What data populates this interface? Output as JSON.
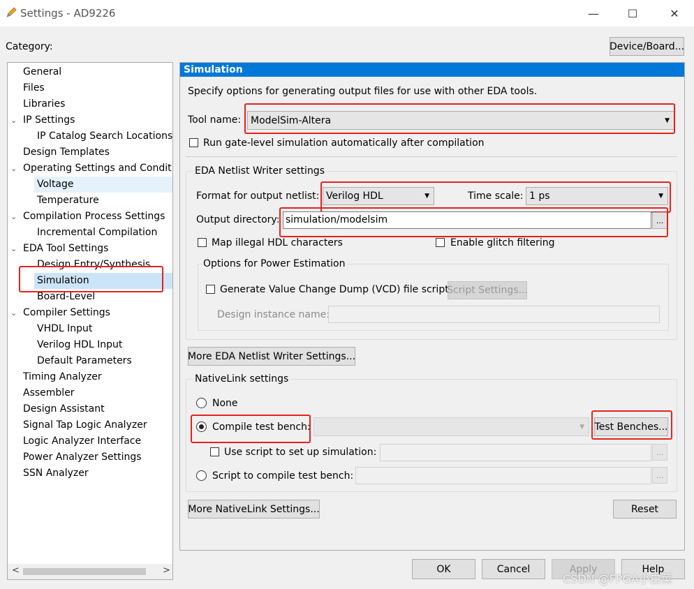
{
  "window": {
    "title": "Settings - AD9226",
    "minimize": "—",
    "maximize": "☐",
    "close": "✕"
  },
  "category_label": "Category:",
  "device_board_button": "Device/Board...",
  "tree": {
    "items": [
      {
        "label": "General"
      },
      {
        "label": "Files"
      },
      {
        "label": "Libraries"
      },
      {
        "label": "IP Settings"
      },
      {
        "label": "IP Catalog Search Locations"
      },
      {
        "label": "Design Templates"
      },
      {
        "label": "Operating Settings and Conditions"
      },
      {
        "label": "Voltage"
      },
      {
        "label": "Temperature"
      },
      {
        "label": "Compilation Process Settings"
      },
      {
        "label": "Incremental Compilation"
      },
      {
        "label": "EDA Tool Settings"
      },
      {
        "label": "Design Entry/Synthesis"
      },
      {
        "label": "Simulation"
      },
      {
        "label": "Board-Level"
      },
      {
        "label": "Compiler Settings"
      },
      {
        "label": "VHDL Input"
      },
      {
        "label": "Verilog HDL Input"
      },
      {
        "label": "Default Parameters"
      },
      {
        "label": "Timing Analyzer"
      },
      {
        "label": "Assembler"
      },
      {
        "label": "Design Assistant"
      },
      {
        "label": "Signal Tap Logic Analyzer"
      },
      {
        "label": "Logic Analyzer Interface"
      },
      {
        "label": "Power Analyzer Settings"
      },
      {
        "label": "SSN Analyzer"
      }
    ],
    "selected": "Simulation"
  },
  "panel": {
    "header": "Simulation",
    "description": "Specify options for generating output files for use with other EDA tools.",
    "tool_name_label": "Tool name:",
    "tool_name_value": "ModelSim-Altera",
    "run_gate_level_label": "Run gate-level simulation automatically after compilation",
    "eda_netlist": {
      "title": "EDA Netlist Writer settings",
      "format_label": "Format for output netlist:",
      "format_value": "Verilog HDL",
      "time_scale_label": "Time scale:",
      "time_scale_value": "1 ps",
      "output_dir_label": "Output directory:",
      "output_dir_value": "simulation/modelsim",
      "browse": "...",
      "map_illegal_label": "Map illegal HDL characters",
      "glitch_label": "Enable glitch filtering",
      "power": {
        "title": "Options for Power Estimation",
        "vcd_label": "Generate Value Change Dump (VCD) file script",
        "script_settings": "Script Settings...",
        "design_instance_label": "Design instance name:"
      }
    },
    "more_eda_button": "More EDA Netlist Writer Settings...",
    "nativelink": {
      "title": "NativeLink settings",
      "none_label": "None",
      "compile_tb_label": "Compile test bench:",
      "test_benches_button": "Test Benches...",
      "use_script_label": "Use script to set up simulation:",
      "script_compile_label": "Script to compile test bench:",
      "browse": "..."
    },
    "more_nativelink_button": "More NativeLink Settings...",
    "reset_button": "Reset"
  },
  "footer": {
    "ok": "OK",
    "cancel": "Cancel",
    "apply": "Apply",
    "help": "Help"
  },
  "watermark": "CSDN @FPGA小白菜",
  "colors": {
    "accent": "#0078d7",
    "highlight": "#e5221e"
  }
}
